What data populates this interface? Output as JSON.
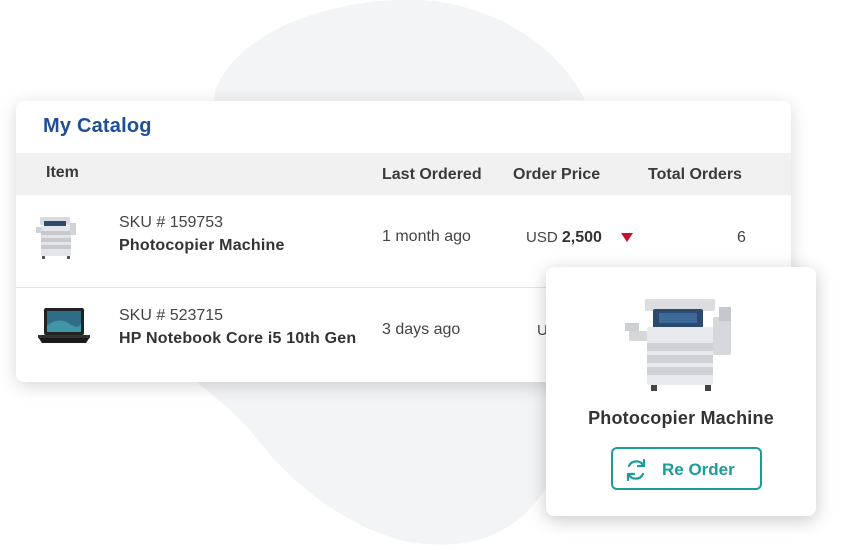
{
  "catalog": {
    "title": "My Catalog",
    "columns": {
      "item": "Item",
      "last_ordered": "Last Ordered",
      "order_price": "Order Price",
      "total_orders": "Total Orders"
    },
    "rows": [
      {
        "sku": "SKU # 159753",
        "name": "Photocopier Machine",
        "last_ordered": "1 month ago",
        "currency": "USD",
        "price": "2,500",
        "price_trend": "down",
        "total_orders": "6",
        "thumbnail_icon": "photocopier-icon"
      },
      {
        "sku": "SKU # 523715",
        "name": "HP Notebook Core i5 10th Gen",
        "last_ordered": "3 days ago",
        "currency_partial": "U",
        "thumbnail_icon": "laptop-icon"
      }
    ]
  },
  "reorder_card": {
    "product_name": "Photocopier Machine",
    "button_label": "Re Order",
    "button_icon": "refresh-icon"
  },
  "colors": {
    "title_blue": "#1f4e99",
    "accent_teal": "#1a9c98",
    "trend_down_red": "#c8102e",
    "header_bg": "#f1f1f2"
  }
}
